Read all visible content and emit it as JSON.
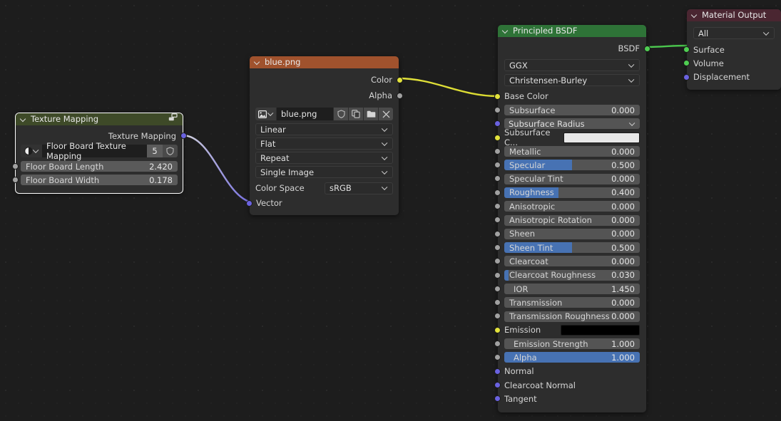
{
  "editor": {
    "name": "Blender Shader Node Editor",
    "background": "#1d1d1d"
  },
  "colors": {
    "socket_grey": "#a1a1a1",
    "socket_yellow": "#e2e23c",
    "socket_purple": "#6a62e0",
    "socket_green": "#4fce52",
    "header_group": "#3e4a28",
    "header_texture": "#a0522d",
    "header_shader": "#2e7337",
    "header_output": "#4a2631",
    "slider_fill": "#4772b3",
    "node_body": "#2d2d2d",
    "active_outline": "#ffffff"
  },
  "nodes": {
    "texture_mapping": {
      "title": "Texture Mapping",
      "header_icon": "node-group-icon",
      "selected": true,
      "outputs": [
        {
          "name": "Texture Mapping",
          "socket": "purple"
        }
      ],
      "datablock": {
        "icon": "node-tree-icon",
        "value": "Floor Board Texture Mapping",
        "users": "5",
        "fake_user_icon": "shield-icon"
      },
      "inputs": [
        {
          "name": "Floor Board Length",
          "value": "2.420",
          "socket": "grey",
          "fill": 0
        },
        {
          "name": "Floor Board Width",
          "value": "0.178",
          "socket": "grey",
          "fill": 0
        }
      ]
    },
    "image_texture": {
      "title": "blue.png",
      "outputs": [
        {
          "name": "Color",
          "socket": "yellow"
        },
        {
          "name": "Alpha",
          "socket": "grey"
        }
      ],
      "datablock": {
        "icon": "image-icon",
        "value": "blue.png",
        "buttons": [
          "shield-icon",
          "copy-icon",
          "folder-icon",
          "close-icon"
        ]
      },
      "menus": [
        "Linear",
        "Flat",
        "Repeat",
        "Single Image"
      ],
      "color_space": {
        "label": "Color Space",
        "value": "sRGB"
      },
      "inputs": [
        {
          "name": "Vector",
          "socket": "purple"
        }
      ]
    },
    "principled_bsdf": {
      "title": "Principled BSDF",
      "outputs": [
        {
          "name": "BSDF",
          "socket": "green"
        }
      ],
      "menus": [
        "GGX",
        "Christensen-Burley"
      ],
      "inputs": [
        {
          "name": "Base Color",
          "socket": "yellow",
          "kind": "linked"
        },
        {
          "name": "Subsurface",
          "socket": "grey",
          "kind": "slider",
          "value": "0.000",
          "fill": 0
        },
        {
          "name": "Subsurface Radius",
          "socket": "purple",
          "kind": "menu"
        },
        {
          "name": "Subsurface C...",
          "socket": "yellow",
          "kind": "color",
          "color": "#e8e8e8"
        },
        {
          "name": "Metallic",
          "socket": "grey",
          "kind": "slider",
          "value": "0.000",
          "fill": 0
        },
        {
          "name": "Specular",
          "socket": "grey",
          "kind": "slider",
          "value": "0.500",
          "fill": 50
        },
        {
          "name": "Specular Tint",
          "socket": "grey",
          "kind": "slider",
          "value": "0.000",
          "fill": 0
        },
        {
          "name": "Roughness",
          "socket": "grey",
          "kind": "slider",
          "value": "0.400",
          "fill": 40
        },
        {
          "name": "Anisotropic",
          "socket": "grey",
          "kind": "slider",
          "value": "0.000",
          "fill": 0
        },
        {
          "name": "Anisotropic Rotation",
          "socket": "grey",
          "kind": "slider",
          "value": "0.000",
          "fill": 0
        },
        {
          "name": "Sheen",
          "socket": "grey",
          "kind": "slider",
          "value": "0.000",
          "fill": 0
        },
        {
          "name": "Sheen Tint",
          "socket": "grey",
          "kind": "slider",
          "value": "0.500",
          "fill": 50
        },
        {
          "name": "Clearcoat",
          "socket": "grey",
          "kind": "slider",
          "value": "0.000",
          "fill": 0
        },
        {
          "name": "Clearcoat Roughness",
          "socket": "grey",
          "kind": "slider",
          "value": "0.030",
          "fill": 3
        },
        {
          "name": "IOR",
          "socket": "grey",
          "kind": "slider",
          "value": "1.450",
          "fill": 0
        },
        {
          "name": "Transmission",
          "socket": "grey",
          "kind": "slider",
          "value": "0.000",
          "fill": 0
        },
        {
          "name": "Transmission Roughness",
          "socket": "grey",
          "kind": "slider",
          "value": "0.000",
          "fill": 0
        },
        {
          "name": "Emission",
          "socket": "yellow",
          "kind": "color",
          "color": "#000000"
        },
        {
          "name": "Emission Strength",
          "socket": "grey",
          "kind": "slider",
          "value": "1.000",
          "fill": 0
        },
        {
          "name": "Alpha",
          "socket": "grey",
          "kind": "slider",
          "value": "1.000",
          "fill": 100
        },
        {
          "name": "Normal",
          "socket": "purple",
          "kind": "linked"
        },
        {
          "name": "Clearcoat Normal",
          "socket": "purple",
          "kind": "linked"
        },
        {
          "name": "Tangent",
          "socket": "purple",
          "kind": "linked"
        }
      ]
    },
    "material_output": {
      "title": "Material Output",
      "target": "All",
      "inputs": [
        {
          "name": "Surface",
          "socket": "green"
        },
        {
          "name": "Volume",
          "socket": "green"
        },
        {
          "name": "Displacement",
          "socket": "purple"
        }
      ]
    }
  },
  "links": [
    {
      "from": "image_texture.Color",
      "to": "principled_bsdf.Base Color",
      "color": "#dede36"
    },
    {
      "from": "texture_mapping.Texture Mapping",
      "to": "image_texture.Vector",
      "color": "#6a62e0"
    },
    {
      "from": "principled_bsdf.BSDF",
      "to": "material_output.Surface",
      "color": "#4fce52"
    }
  ]
}
